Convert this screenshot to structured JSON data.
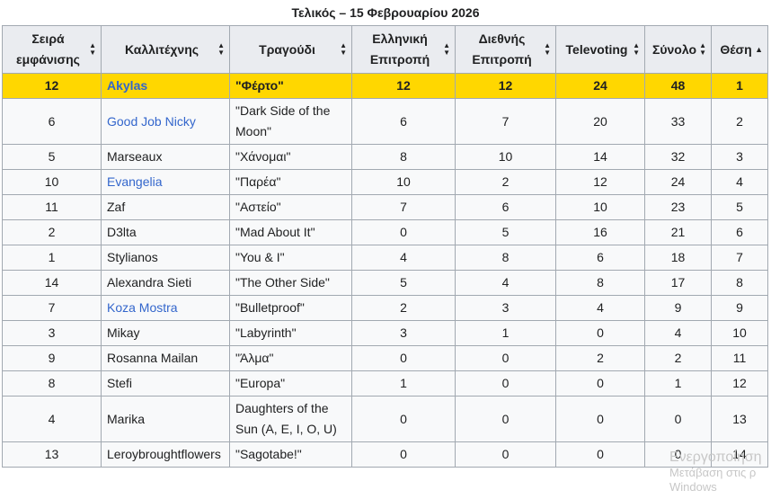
{
  "caption": "Τελικός – 15 Φεβρουαρίου 2026",
  "headers": [
    {
      "label": "Σειρά εμφάνισης",
      "sort": "both"
    },
    {
      "label": "Καλλιτέχνης",
      "sort": "both"
    },
    {
      "label": "Τραγούδι",
      "sort": "both"
    },
    {
      "label": "Ελληνική Επιτροπή",
      "sort": "both"
    },
    {
      "label": "Διεθνής Επιτροπή",
      "sort": "both"
    },
    {
      "label": "Televoting",
      "sort": "both"
    },
    {
      "label": "Σύνολο",
      "sort": "both"
    },
    {
      "label": "Θέση",
      "sort": "asc"
    }
  ],
  "rows": [
    {
      "order": "12",
      "artist": "Akylas",
      "artist_link": true,
      "song": "\"Φέρτο\"",
      "greek": "12",
      "intl": "12",
      "tele": "24",
      "total": "48",
      "place": "1",
      "winner": true
    },
    {
      "order": "6",
      "artist": "Good Job Nicky",
      "artist_link": true,
      "song": "\"Dark Side of the Moon\"",
      "greek": "6",
      "intl": "7",
      "tele": "20",
      "total": "33",
      "place": "2"
    },
    {
      "order": "5",
      "artist": "Marseaux",
      "artist_link": false,
      "song": "\"Χάνομαι\"",
      "greek": "8",
      "intl": "10",
      "tele": "14",
      "total": "32",
      "place": "3"
    },
    {
      "order": "10",
      "artist": "Evangelia",
      "artist_link": true,
      "song": "\"Παρέα\"",
      "greek": "10",
      "intl": "2",
      "tele": "12",
      "total": "24",
      "place": "4"
    },
    {
      "order": "11",
      "artist": "Zaf",
      "artist_link": false,
      "song": "\"Αστείο\"",
      "greek": "7",
      "intl": "6",
      "tele": "10",
      "total": "23",
      "place": "5"
    },
    {
      "order": "2",
      "artist": "D3lta",
      "artist_link": false,
      "song": "\"Mad About It\"",
      "greek": "0",
      "intl": "5",
      "tele": "16",
      "total": "21",
      "place": "6"
    },
    {
      "order": "1",
      "artist": "Stylianos",
      "artist_link": false,
      "song": "\"You & I\"",
      "greek": "4",
      "intl": "8",
      "tele": "6",
      "total": "18",
      "place": "7"
    },
    {
      "order": "14",
      "artist": "Alexandra Sieti",
      "artist_link": false,
      "song": "\"The Other Side\"",
      "greek": "5",
      "intl": "4",
      "tele": "8",
      "total": "17",
      "place": "8"
    },
    {
      "order": "7",
      "artist": "Koza Mostra",
      "artist_link": true,
      "song": "\"Bulletproof\"",
      "greek": "2",
      "intl": "3",
      "tele": "4",
      "total": "9",
      "place": "9"
    },
    {
      "order": "3",
      "artist": "Mikay",
      "artist_link": false,
      "song": "\"Labyrinth\"",
      "greek": "3",
      "intl": "1",
      "tele": "0",
      "total": "4",
      "place": "10"
    },
    {
      "order": "9",
      "artist": "Rosanna Mailan",
      "artist_link": false,
      "song": "\"Άλμα\"",
      "greek": "0",
      "intl": "0",
      "tele": "2",
      "total": "2",
      "place": "11"
    },
    {
      "order": "8",
      "artist": "Stefi",
      "artist_link": false,
      "song": "\"Europa\"",
      "greek": "1",
      "intl": "0",
      "tele": "0",
      "total": "1",
      "place": "12"
    },
    {
      "order": "4",
      "artist": "Marika",
      "artist_link": false,
      "song": "Daughters of the Sun (A, E, I, O, U)",
      "greek": "0",
      "intl": "0",
      "tele": "0",
      "total": "0",
      "place": "13"
    },
    {
      "order": "13",
      "artist": "Leroybroughtflowers",
      "artist_link": false,
      "song": "\"Sagotabe!\"",
      "greek": "0",
      "intl": "0",
      "tele": "0",
      "total": "0",
      "place": "14"
    }
  ],
  "watermark": {
    "line1": "Ενεργοποίηση",
    "line2": "Μετάβαση στις ρ",
    "line3": "Windows"
  },
  "colors": {
    "winner_bg": "#ffd700",
    "link": "#3366cc",
    "header_bg": "#eaecf0",
    "cell_bg": "#f8f9fa",
    "border": "#a2a9b1"
  }
}
